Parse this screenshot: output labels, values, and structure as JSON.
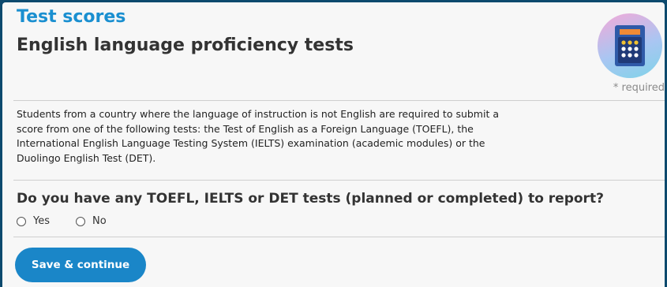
{
  "header": {
    "section_title": "Test scores",
    "page_title": "English language proficiency tests",
    "icon": "calculator-icon",
    "required_note": "* required"
  },
  "intro": {
    "text": "Students from a country where the language of instruction is not English are required to submit a score from one of the following tests: the Test of English as a Foreign Language (TOEFL), the International English Language Testing System (IELTS) examination (academic modules) or the Duolingo English Test (DET)."
  },
  "question": {
    "text": "Do you have any TOEFL, IELTS or DET tests (planned or completed) to report?",
    "options": [
      {
        "label": "Yes",
        "selected": false
      },
      {
        "label": "No",
        "selected": false
      }
    ]
  },
  "actions": {
    "save_label": "Save & continue"
  },
  "colors": {
    "accent": "#1a8fd0",
    "button": "#1a86c8",
    "frame": "#0d4a6e",
    "panel": "#f7f7f7"
  }
}
